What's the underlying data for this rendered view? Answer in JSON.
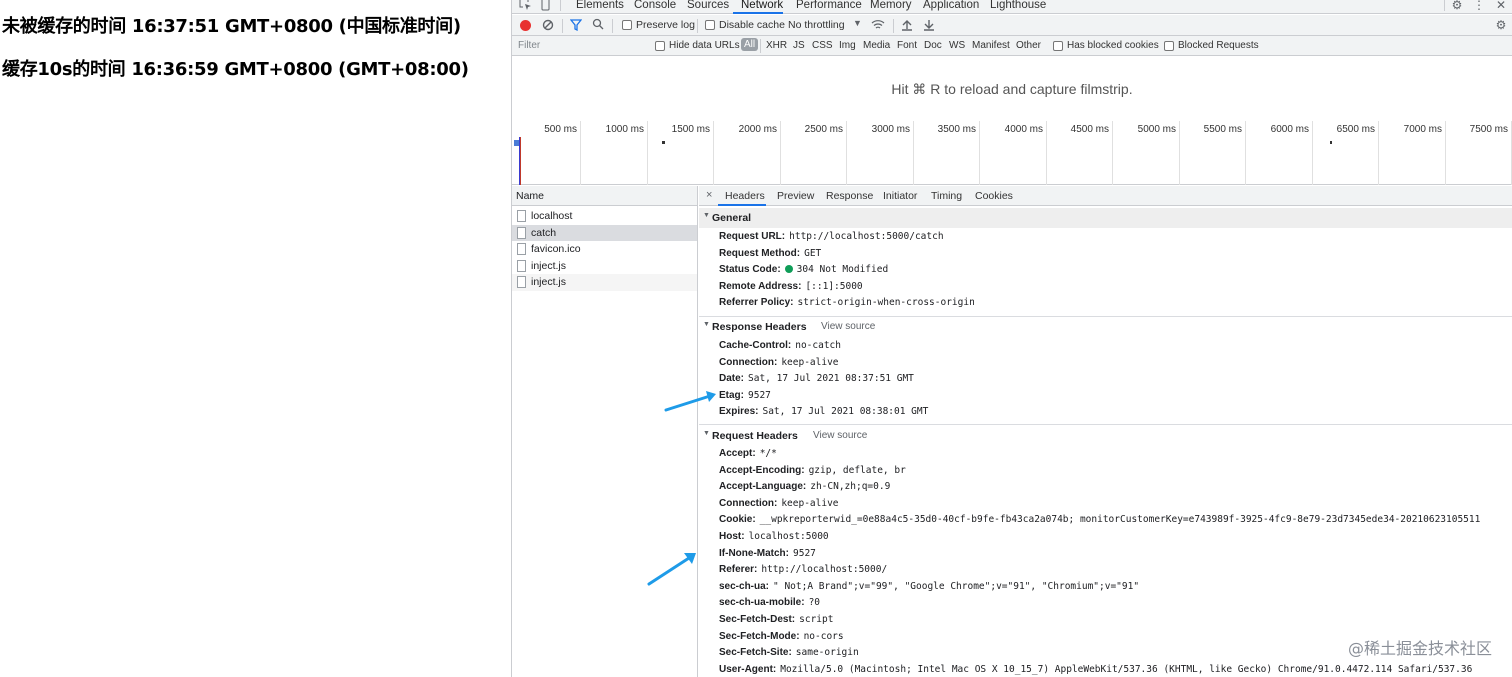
{
  "page": {
    "line1": "未被缓存的时间 16:37:51 GMT+0800 (中国标准时间)",
    "line2": "缓存10s的时间 16:36:59 GMT+0800 (GMT+08:00)"
  },
  "devtools": {
    "tabs": [
      "Elements",
      "Console",
      "Sources",
      "Network",
      "Performance",
      "Memory",
      "Application",
      "Lighthouse"
    ],
    "active_tab": "Network",
    "toolbar": {
      "preserve_log": "Preserve log",
      "disable_cache": "Disable cache",
      "throttling": "No throttling"
    },
    "filter_bar": {
      "filter_placeholder": "Filter",
      "hide_data_urls": "Hide data URLs",
      "types": [
        "All",
        "XHR",
        "JS",
        "CSS",
        "Img",
        "Media",
        "Font",
        "Doc",
        "WS",
        "Manifest",
        "Other"
      ],
      "active_type": "All",
      "has_blocked_cookies": "Has blocked cookies",
      "blocked_requests": "Blocked Requests"
    },
    "filmstrip_message": "Hit ⌘ R to reload and capture filmstrip.",
    "timeline_ticks": [
      "500 ms",
      "1000 ms",
      "1500 ms",
      "2000 ms",
      "2500 ms",
      "3000 ms",
      "3500 ms",
      "4000 ms",
      "4500 ms",
      "5000 ms",
      "5500 ms",
      "6000 ms",
      "6500 ms",
      "7000 ms",
      "7500 ms"
    ],
    "name_header": "Name",
    "requests": [
      "localhost",
      "catch",
      "favicon.ico",
      "inject.js",
      "inject.js"
    ],
    "selected_request": "catch",
    "detail_tabs": [
      "Headers",
      "Preview",
      "Response",
      "Initiator",
      "Timing",
      "Cookies"
    ],
    "active_detail_tab": "Headers",
    "general": {
      "title": "General",
      "rows": [
        {
          "key": "Request URL:",
          "value": "http://localhost:5000/catch"
        },
        {
          "key": "Request Method:",
          "value": "GET"
        },
        {
          "key": "Status Code:",
          "value": "304 Not Modified"
        },
        {
          "key": "Remote Address:",
          "value": "[::1]:5000"
        },
        {
          "key": "Referrer Policy:",
          "value": "strict-origin-when-cross-origin"
        }
      ]
    },
    "response_headers": {
      "title": "Response Headers",
      "view_source": "View source",
      "rows": [
        {
          "key": "Cache-Control:",
          "value": "no-catch"
        },
        {
          "key": "Connection:",
          "value": "keep-alive"
        },
        {
          "key": "Date:",
          "value": "Sat, 17 Jul 2021 08:37:51 GMT"
        },
        {
          "key": "Etag:",
          "value": "9527"
        },
        {
          "key": "Expires:",
          "value": "Sat, 17 Jul 2021 08:38:01 GMT"
        }
      ]
    },
    "request_headers": {
      "title": "Request Headers",
      "view_source": "View source",
      "rows": [
        {
          "key": "Accept:",
          "value": "*/*"
        },
        {
          "key": "Accept-Encoding:",
          "value": "gzip, deflate, br"
        },
        {
          "key": "Accept-Language:",
          "value": "zh-CN,zh;q=0.9"
        },
        {
          "key": "Connection:",
          "value": "keep-alive"
        },
        {
          "key": "Cookie:",
          "value": "__wpkreporterwid_=0e88a4c5-35d0-40cf-b9fe-fb43ca2a074b; monitorCustomerKey=e743989f-3925-4fc9-8e79-23d7345ede34-20210623105511"
        },
        {
          "key": "Host:",
          "value": "localhost:5000"
        },
        {
          "key": "If-None-Match:",
          "value": "9527"
        },
        {
          "key": "Referer:",
          "value": "http://localhost:5000/"
        },
        {
          "key": "sec-ch-ua:",
          "value": "\" Not;A Brand\";v=\"99\", \"Google Chrome\";v=\"91\", \"Chromium\";v=\"91\""
        },
        {
          "key": "sec-ch-ua-mobile:",
          "value": "?0"
        },
        {
          "key": "Sec-Fetch-Dest:",
          "value": "script"
        },
        {
          "key": "Sec-Fetch-Mode:",
          "value": "no-cors"
        },
        {
          "key": "Sec-Fetch-Site:",
          "value": "same-origin"
        },
        {
          "key": "User-Agent:",
          "value": "Mozilla/5.0 (Macintosh; Intel Mac OS X 10_15_7) AppleWebKit/537.36 (KHTML, like Gecko) Chrome/91.0.4472.114 Safari/537.36"
        }
      ]
    },
    "colors": {
      "accent": "#1a73e8",
      "record": "#e8312f",
      "status_ok": "#0f9d58",
      "annotation_arrow": "#1e9be8"
    }
  },
  "watermark": "@稀土掘金技术社区"
}
